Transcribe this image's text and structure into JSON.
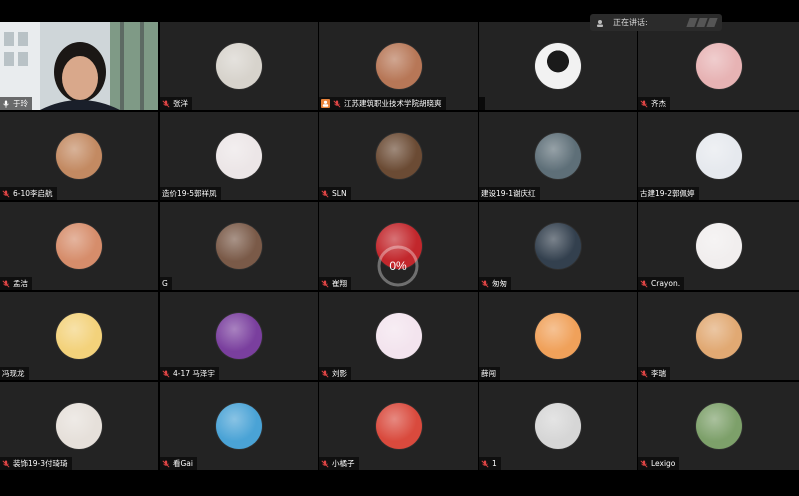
{
  "speaking": {
    "label": "正在讲话:"
  },
  "loader": {
    "progress_text": "0%",
    "progress": 0.0
  },
  "participants": [
    {
      "name": "于玲",
      "icon": "mic-icon",
      "video": true
    },
    {
      "name": "张洋",
      "icon": "mute-icon",
      "avatar_color": "#d7d3cc"
    },
    {
      "name": "江苏建筑职业技术学院胡晓爽",
      "icon": "mute-icon",
      "host": true,
      "avatar_color": "#b77757"
    },
    {
      "name": "",
      "icon": "",
      "avatar_color": "#f2f2f2",
      "dot_only": true
    },
    {
      "name": "齐杰",
      "icon": "mute-icon",
      "avatar_color": "#e7b3b4"
    },
    {
      "name": "6-10李启航",
      "icon": "mute-icon",
      "avatar_color": "#c38a62"
    },
    {
      "name": "造价19-5郭祥凤",
      "icon": "",
      "avatar_color": "#ece6e7"
    },
    {
      "name": "SLN",
      "icon": "mute-icon",
      "avatar_color": "#6b4b34"
    },
    {
      "name": "建设19-1谢庆红",
      "icon": "",
      "avatar_color": "#5e6f78"
    },
    {
      "name": "古建19-2郭佩婷",
      "icon": "",
      "avatar_color": "#e6e9ee"
    },
    {
      "name": "孟洁",
      "icon": "mute-icon",
      "avatar_color": "#d68d6b"
    },
    {
      "name": "G",
      "icon": "",
      "avatar_color": "#7a5a48"
    },
    {
      "name": "崔翔",
      "icon": "mute-icon",
      "avatar_color": "#c2272c"
    },
    {
      "name": "匆匆",
      "icon": "mute-icon",
      "avatar_color": "#33404e"
    },
    {
      "name": "Crayon.",
      "icon": "mute-icon",
      "avatar_color": "#f1eeee"
    },
    {
      "name": "冯现龙",
      "icon": "",
      "avatar_color": "#f3d27b"
    },
    {
      "name": "4-17 马泽宇",
      "icon": "mute-icon",
      "avatar_color": "#7a3f9e"
    },
    {
      "name": "刘影",
      "icon": "mute-icon",
      "avatar_color": "#f3e4ee"
    },
    {
      "name": "薛闯",
      "icon": "",
      "avatar_color": "#f0a15a"
    },
    {
      "name": "李瑞",
      "icon": "mute-icon",
      "avatar_color": "#e1a973"
    },
    {
      "name": "装饰19-3付琦琦",
      "icon": "mute-icon",
      "avatar_color": "#e6e0da"
    },
    {
      "name": "看Gai",
      "icon": "mute-icon",
      "avatar_color": "#4aa3d6"
    },
    {
      "name": "小橘子",
      "icon": "mute-icon",
      "avatar_color": "#d94a3d"
    },
    {
      "name": "1",
      "icon": "mute-icon",
      "avatar_color": "#d6d6d6"
    },
    {
      "name": "Lexigo",
      "icon": "mute-icon",
      "avatar_color": "#7da06a"
    }
  ]
}
